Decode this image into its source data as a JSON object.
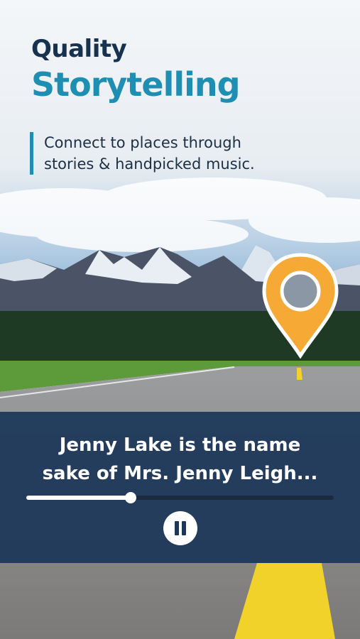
{
  "header": {
    "eyebrow": "Quality",
    "title": "Storytelling",
    "tagline_line1": "Connect to places through",
    "tagline_line2": "stories & handpicked music."
  },
  "player": {
    "story_line1": "Jenny Lake is the name",
    "story_line2": "sake of Mrs. Jenny Leigh...",
    "progress": 0.34,
    "state": "playing",
    "control_icon": "pause-icon"
  },
  "map_pin": {
    "icon": "location-pin-icon",
    "color": "#f6a935"
  },
  "colors": {
    "title_blue": "#1e8fb2",
    "navy": "#17324f",
    "player_bg": "#1c3758",
    "pin_orange": "#f6a935",
    "road_line": "#f1d22a"
  }
}
